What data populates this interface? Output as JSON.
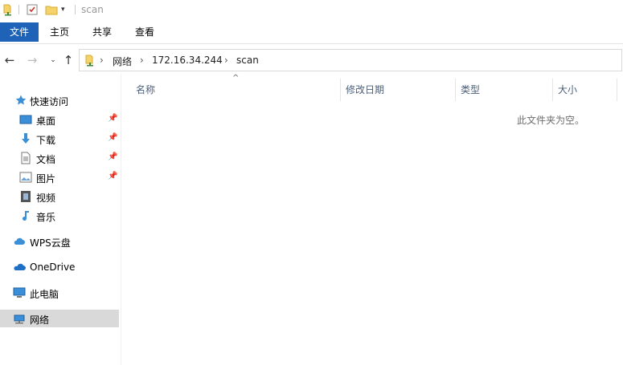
{
  "window": {
    "title": "scan"
  },
  "ribbon": {
    "tabs": [
      "文件",
      "主页",
      "共享",
      "查看"
    ]
  },
  "address_bar": {
    "crumbs": [
      "网络",
      "172.16.34.244",
      "scan"
    ]
  },
  "sidebar": {
    "quick_access": "快速访问",
    "items": [
      {
        "label": "桌面",
        "icon": "desktop-icon",
        "pinned": true
      },
      {
        "label": "下载",
        "icon": "download-icon",
        "pinned": true
      },
      {
        "label": "文档",
        "icon": "document-icon",
        "pinned": true
      },
      {
        "label": "图片",
        "icon": "pictures-icon",
        "pinned": true
      },
      {
        "label": "视频",
        "icon": "video-icon",
        "pinned": false
      },
      {
        "label": "音乐",
        "icon": "music-icon",
        "pinned": false
      }
    ],
    "wps": "WPS云盘",
    "onedrive": "OneDrive",
    "this_pc": "此电脑",
    "network": "网络"
  },
  "columns": {
    "name": "名称",
    "modified": "修改日期",
    "type": "类型",
    "size": "大小"
  },
  "empty_message": "此文件夹为空。",
  "colors": {
    "file_tab": "#1e63b8",
    "selected_bg": "#d9d9d9",
    "header_text": "#4c607a"
  }
}
